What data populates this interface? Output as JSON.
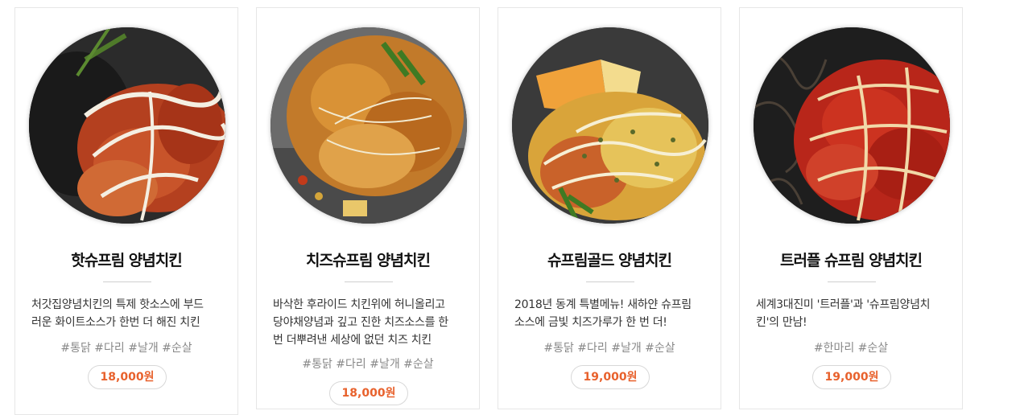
{
  "products": [
    {
      "name": "핫슈프림 양념치킨",
      "desc_lines": [
        "처갓집양념치킨의 특제 핫소스에 부드",
        "러운 화이트소스가 한번 더 해진 치킨"
      ],
      "tags": "#통닭 #다리 #날개 #순살",
      "price": "18,000원"
    },
    {
      "name": "치즈슈프림 양념치킨",
      "desc_lines": [
        "바삭한 후라이드 치킨위에 허니올리고",
        "당야채양념과 깊고 진한 치즈소스를 한",
        "번 더뿌려낸 세상에 없던 치즈 치킨"
      ],
      "tags": "#통닭 #다리 #날개 #순살",
      "price": "18,000원"
    },
    {
      "name": "슈프림골드 양념치킨",
      "desc_lines": [
        "2018년 동계 특별메뉴! 새하얀 슈프림",
        "소스에 금빛 치즈가루가 한 번 더!"
      ],
      "tags": "#통닭 #다리 #날개 #순살",
      "price": "19,000원"
    },
    {
      "name": "트러플 슈프림 양념치킨",
      "desc_lines": [
        "세계3대진미 '트러플'과 '슈프림양념치",
        "킨'의 만남!"
      ],
      "tags": "#한마리 #순살",
      "price": "19,000원"
    }
  ],
  "colors": {
    "price_text": "#e8612c",
    "tag_text": "#888888",
    "border": "#e6e6e6"
  }
}
